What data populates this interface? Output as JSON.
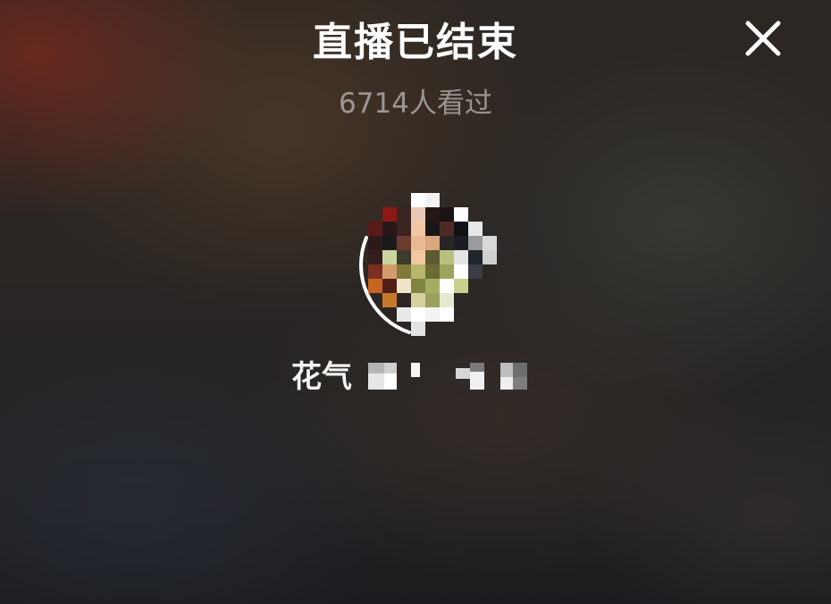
{
  "header": {
    "title": "直播已结束",
    "viewers": "6714人看过"
  },
  "actions": {
    "close_icon": "close-icon"
  },
  "streamer": {
    "name_visible": "花气",
    "avatar": "pixelated-avatar",
    "name_obscured": "pixelated-name-suffix"
  },
  "colors": {
    "title": "#ffffff",
    "subtitle": "#8c8a88",
    "ring": "#ffffff"
  }
}
